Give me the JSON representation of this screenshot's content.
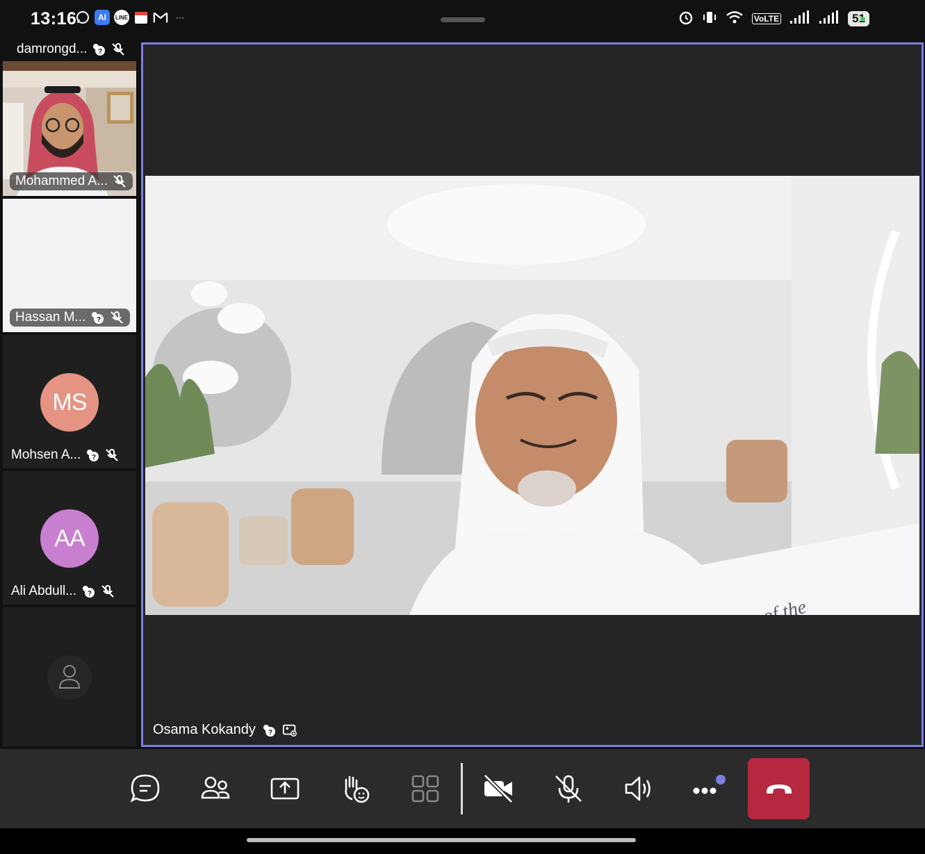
{
  "status_bar": {
    "time": "13:16",
    "app_icons": [
      "whatsapp-icon",
      "ai-icon",
      "line-icon",
      "calendar-icon",
      "gmail-icon",
      "more-dots"
    ],
    "more": "···",
    "network_label": "VoLTE",
    "battery": "51"
  },
  "participants": [
    {
      "name": "damrongd...",
      "type": "name-only"
    },
    {
      "name": "Mohammed A...",
      "type": "video"
    },
    {
      "name": "Hassan M...",
      "type": "video"
    },
    {
      "name": "Mohsen A...",
      "type": "avatar",
      "initials": "MS",
      "color": "#e59484"
    },
    {
      "name": "Ali Abdull...",
      "type": "avatar",
      "initials": "AA",
      "color": "#c97fcf"
    },
    {
      "name": "",
      "type": "placeholder"
    }
  ],
  "main_speaker": {
    "name": "Osama Kokandy",
    "border_color": "#7b7fe0"
  },
  "toolbar": {
    "buttons": [
      "chat",
      "people",
      "share",
      "raise-hand-reactions",
      "view",
      "camera-off",
      "mic-off",
      "speaker",
      "more",
      "leave"
    ],
    "end_call_color": "#b5283f"
  }
}
